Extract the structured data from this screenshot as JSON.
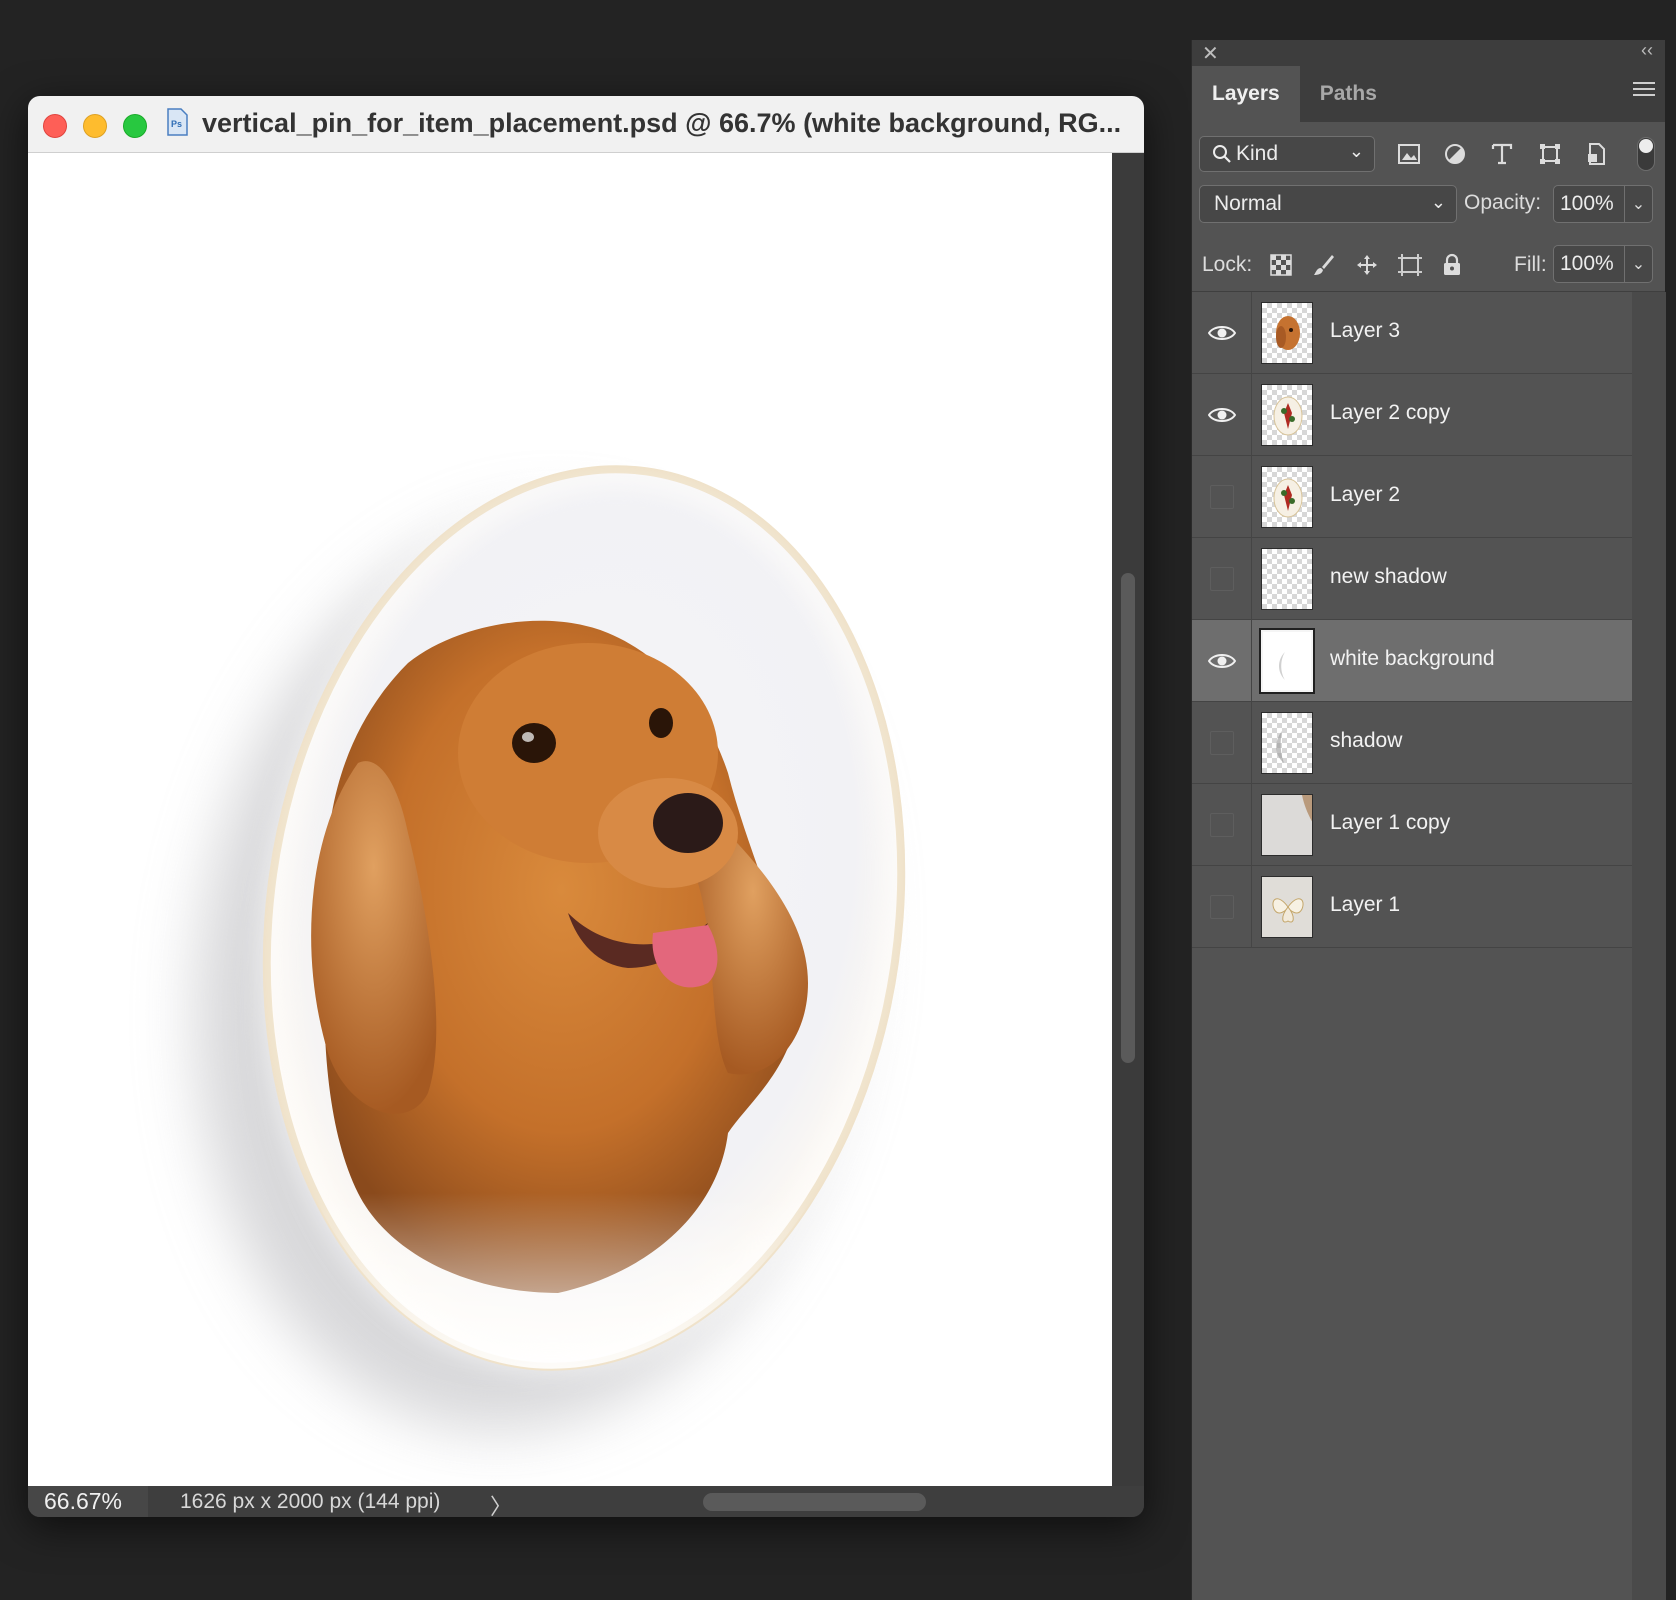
{
  "document": {
    "title": "vertical_pin_for_item_placement.psd @ 66.7% (white background, RG...",
    "zoom": "66.67%",
    "info": "1626 px x 2000 px (144 ppi)",
    "status_arrow": "〉"
  },
  "panel": {
    "close_glyph": "✕",
    "collapse_glyph": "‹‹",
    "tabs": [
      {
        "label": "Layers",
        "active": true
      },
      {
        "label": "Paths",
        "active": false
      }
    ],
    "filter": {
      "kind_label": "Kind",
      "icons": [
        "image-filter-icon",
        "adjustment-filter-icon",
        "type-filter-icon",
        "shape-filter-icon",
        "smart-object-filter-icon"
      ]
    },
    "blend_mode": "Normal",
    "opacity_label": "Opacity:",
    "opacity_value": "100%",
    "lock_label": "Lock:",
    "fill_label": "Fill:",
    "fill_value": "100%",
    "layers": [
      {
        "name": "Layer 3",
        "visible": true,
        "selected": false,
        "thumb": "dog"
      },
      {
        "name": "Layer 2 copy",
        "visible": true,
        "selected": false,
        "thumb": "ornament"
      },
      {
        "name": "Layer 2",
        "visible": false,
        "selected": false,
        "thumb": "ornament"
      },
      {
        "name": "new shadow",
        "visible": false,
        "selected": false,
        "thumb": "transparent"
      },
      {
        "name": "white background",
        "visible": true,
        "selected": true,
        "thumb": "white-oval"
      },
      {
        "name": "shadow",
        "visible": false,
        "selected": false,
        "thumb": "shadow"
      },
      {
        "name": "Layer 1 copy",
        "visible": false,
        "selected": false,
        "thumb": "texture"
      },
      {
        "name": "Layer 1",
        "visible": false,
        "selected": false,
        "thumb": "pin"
      }
    ]
  },
  "colors": {
    "app_background": "#232323",
    "panel_background": "#535353",
    "selected_row": "#6e6e6e",
    "traffic_red": "#fe5f57",
    "traffic_yellow": "#febc2e",
    "traffic_green": "#28c840"
  }
}
